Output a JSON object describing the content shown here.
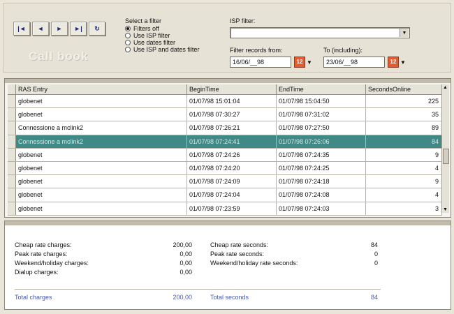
{
  "toolbar": {
    "nav_buttons": [
      {
        "icon": "first-record-icon",
        "glyph": "|◄"
      },
      {
        "icon": "previous-record-icon",
        "glyph": "◄"
      },
      {
        "icon": "next-record-icon",
        "glyph": "►"
      },
      {
        "icon": "last-record-icon",
        "glyph": "►|"
      },
      {
        "icon": "refresh-icon",
        "glyph": "↻"
      }
    ],
    "app_title": "Call book",
    "filter_title": "Select a filter",
    "filters": [
      "Filters off",
      "Use ISP filter",
      "Use dates filter",
      "Use ISP and dates filter"
    ],
    "selected_filter": "Filters off",
    "isp_label": "ISP filter:",
    "isp_value": "",
    "from_label": "Filter records from:",
    "from_value": "16/06/__98",
    "to_label": "To (including):",
    "to_value": "23/06/__98"
  },
  "grid": {
    "headers": [
      "RAS Entry",
      "BeginTime",
      "EndTime",
      "SecondsOnline"
    ],
    "rows": [
      {
        "entry": "globenet",
        "begin": "01/07/98 15:01:04",
        "end": "01/07/98 15:04:50",
        "seconds": "225"
      },
      {
        "entry": "globenet",
        "begin": "01/07/98 07:30:27",
        "end": "01/07/98 07:31:02",
        "seconds": "35"
      },
      {
        "entry": "Connessione a mclink2",
        "begin": "01/07/98 07:26:21",
        "end": "01/07/98 07:27:50",
        "seconds": "89"
      },
      {
        "entry": "Connessione a mclink2",
        "begin": "01/07/98 07:24:41",
        "end": "01/07/98 07:26:06",
        "seconds": "84",
        "selected": true
      },
      {
        "entry": "globenet",
        "begin": "01/07/98 07:24:26",
        "end": "01/07/98 07:24:35",
        "seconds": "9"
      },
      {
        "entry": "globenet",
        "begin": "01/07/98 07:24:20",
        "end": "01/07/98 07:24:25",
        "seconds": "4"
      },
      {
        "entry": "globenet",
        "begin": "01/07/98 07:24:09",
        "end": "01/07/98 07:24:18",
        "seconds": "9"
      },
      {
        "entry": "globenet",
        "begin": "01/07/98 07:24:04",
        "end": "01/07/98 07:24:08",
        "seconds": "4"
      },
      {
        "entry": "globenet",
        "begin": "01/07/98 07:23:59",
        "end": "01/07/98 07:24:03",
        "seconds": "3"
      }
    ]
  },
  "summary": {
    "cheap_rate_charges_label": "Cheap rate charges:",
    "cheap_rate_charges": "200,00",
    "peak_rate_charges_label": "Peak rate charges:",
    "peak_rate_charges": "0,00",
    "weekend_charges_label": "Weekend/holiday charges:",
    "weekend_charges": "0,00",
    "dialup_charges_label": "Dialup charges:",
    "dialup_charges": "0,00",
    "total_charges_label": "Total charges",
    "total_charges": "200,00",
    "cheap_rate_seconds_label": "Cheap rate seconds:",
    "cheap_rate_seconds": "84",
    "peak_rate_seconds_label": "Peak rate seconds:",
    "peak_rate_seconds": "0",
    "weekend_rate_seconds_label": "Weekend/holiday rate seconds:",
    "weekend_rate_seconds": "0",
    "total_seconds_label": "Total seconds",
    "total_seconds": "84"
  }
}
